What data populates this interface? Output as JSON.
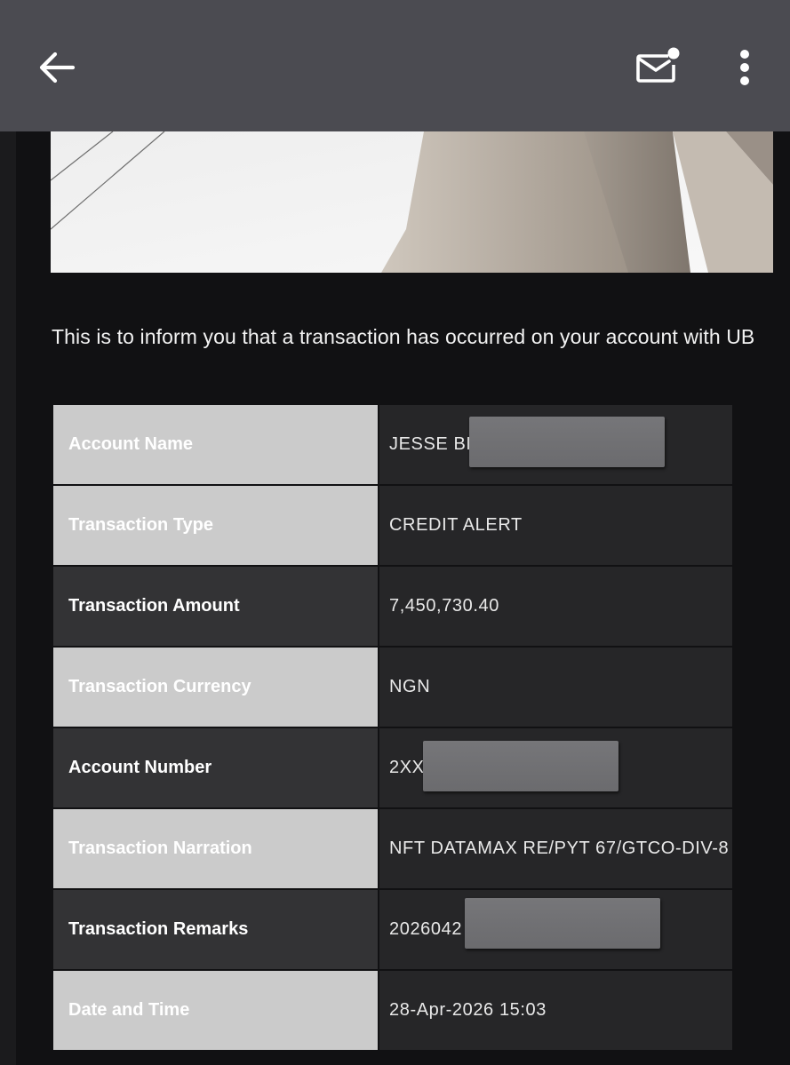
{
  "toolbar": {
    "back_icon": "arrow-left-icon",
    "mail_icon": "mail-unread-icon",
    "more_icon": "more-vertical-icon",
    "background": "#4b4b51"
  },
  "email": {
    "intro_text": "This is to inform you that a transaction has occurred on your account with UB",
    "details": [
      {
        "label": "Account Name",
        "value": "JESSE BE",
        "redacted": true
      },
      {
        "label": "Transaction Type",
        "value": "CREDIT ALERT",
        "redacted": false
      },
      {
        "label": "Transaction Amount",
        "value": "7,450,730.40",
        "redacted": false
      },
      {
        "label": "Transaction Currency",
        "value": "NGN",
        "redacted": false
      },
      {
        "label": "Account Number",
        "value": "2XX",
        "redacted": true
      },
      {
        "label": "Transaction Narration",
        "value": "NFT DATAMAX RE/PYT 67/GTCO-DIV-8",
        "redacted": false
      },
      {
        "label": "Transaction Remarks",
        "value": "2026042",
        "redacted": true
      },
      {
        "label": "Date and Time",
        "value": "28-Apr-2026 15:03",
        "redacted": false
      }
    ]
  }
}
